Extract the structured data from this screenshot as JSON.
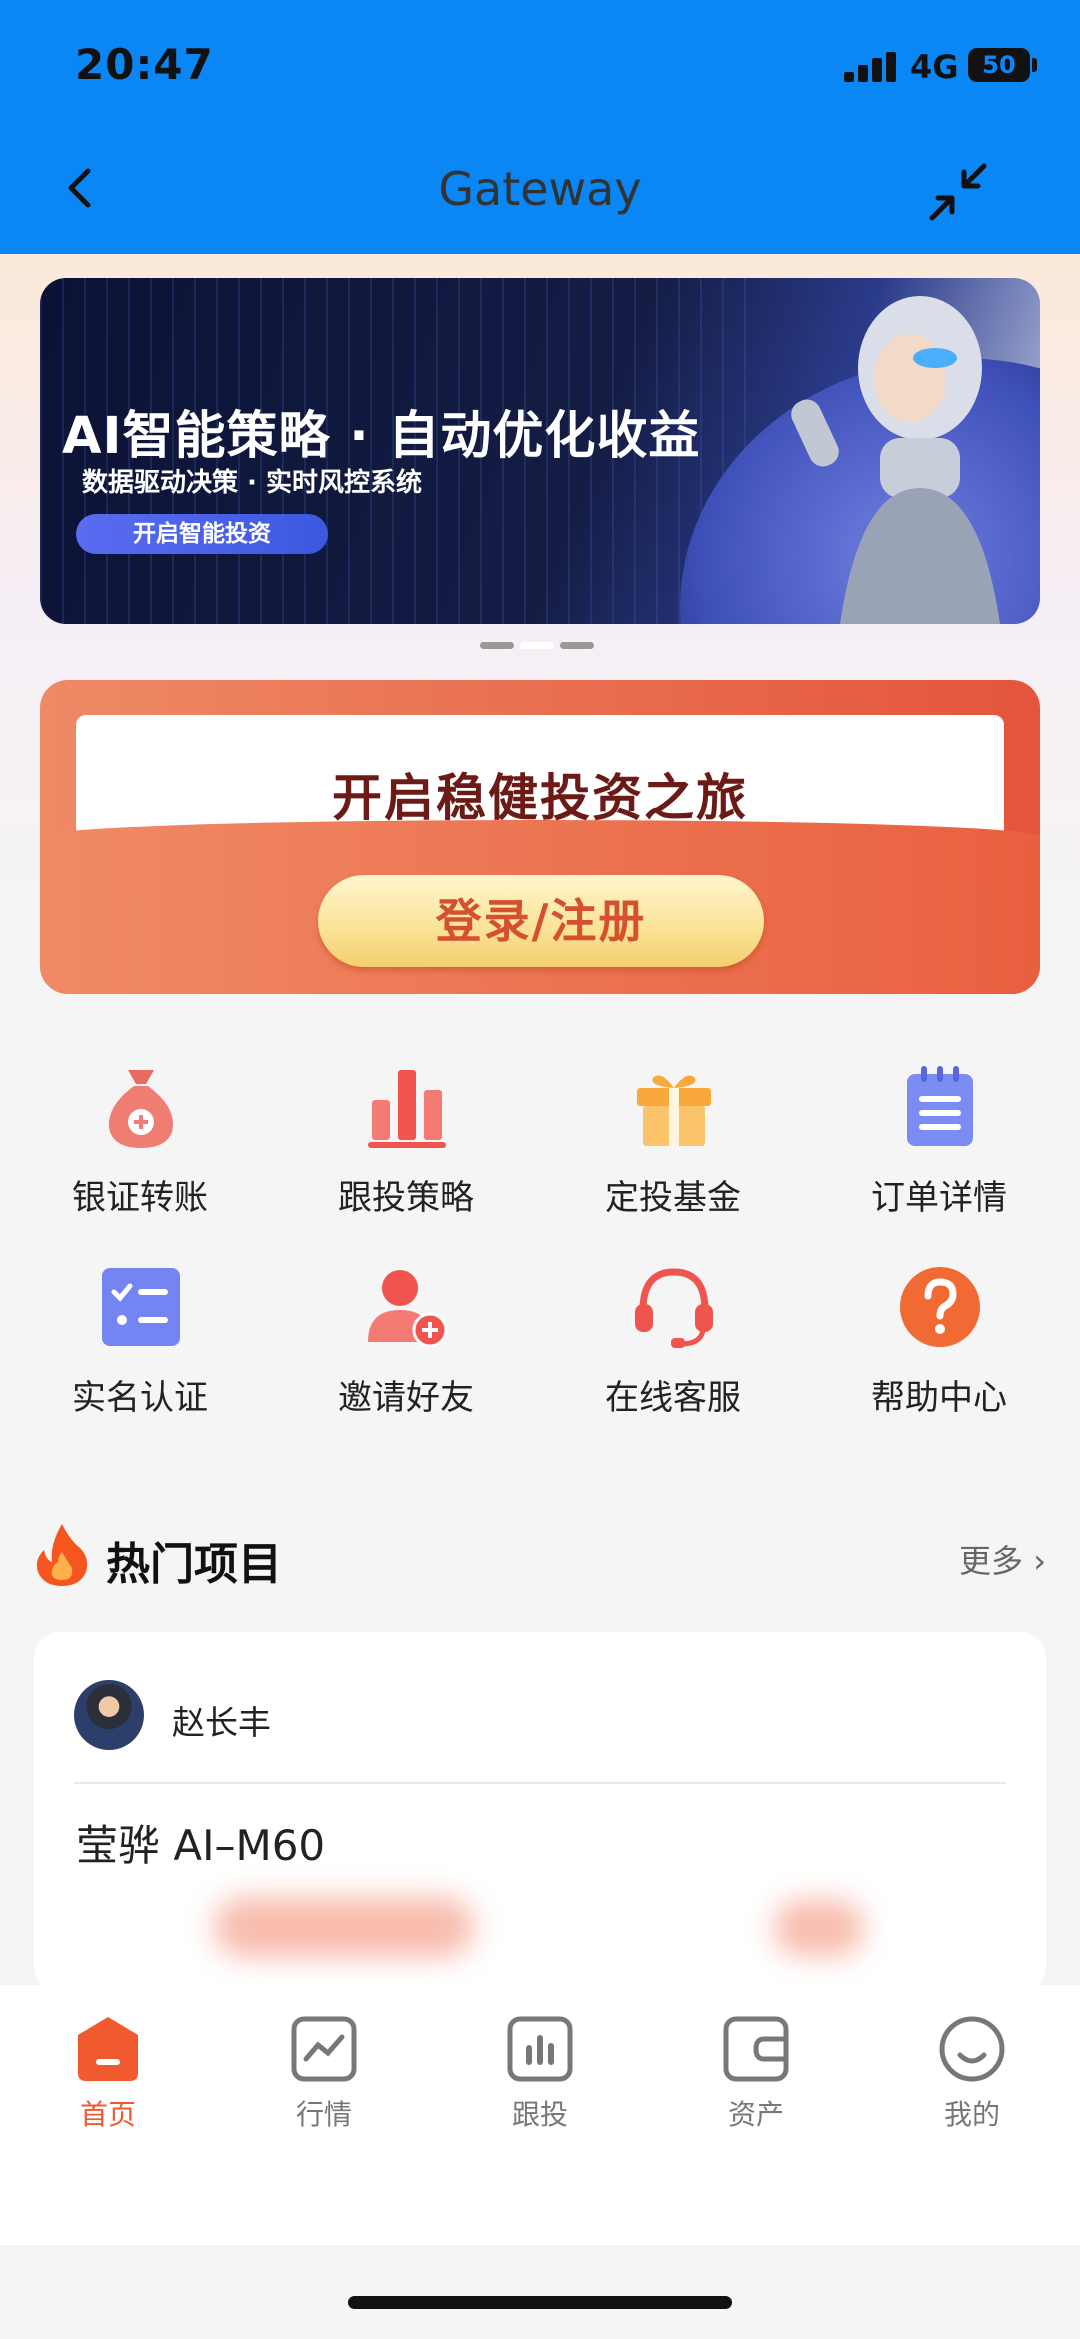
{
  "status_bar": {
    "time": "20:47",
    "network": "4G",
    "battery": "50"
  },
  "header": {
    "title": "Gateway"
  },
  "banner": {
    "title": "AI智能策略 · 自动优化收益",
    "subtitle": "数据驱动决策 · 实时风控系统",
    "button": "开启智能投资",
    "pager": {
      "count": 3,
      "active": 2
    }
  },
  "login_card": {
    "headline": "开启稳健投资之旅",
    "button": "登录/注册"
  },
  "quick_menu": [
    {
      "label": "银证转账",
      "icon": "money-bag-icon",
      "color": "#e96a5e"
    },
    {
      "label": "跟投策略",
      "icon": "bar-chart-icon",
      "color": "#f0544f"
    },
    {
      "label": "定投基金",
      "icon": "gift-icon",
      "color": "#f8b54a"
    },
    {
      "label": "订单详情",
      "icon": "notepad-icon",
      "color": "#6f7ef2"
    },
    {
      "label": "实名认证",
      "icon": "checklist-icon",
      "color": "#6f7ef2"
    },
    {
      "label": "邀请好友",
      "icon": "add-user-icon",
      "color": "#f0544f"
    },
    {
      "label": "在线客服",
      "icon": "headset-icon",
      "color": "#f0544f"
    },
    {
      "label": "帮助中心",
      "icon": "help-icon",
      "color": "#f26a33"
    }
  ],
  "hot": {
    "title": "热门项目",
    "more": "更多",
    "item": {
      "manager": "赵长丰",
      "product": "莹骅 AI–M60"
    }
  },
  "tabs": [
    {
      "label": "首页",
      "icon": "home-icon",
      "active": true
    },
    {
      "label": "行情",
      "icon": "market-chart-icon",
      "active": false
    },
    {
      "label": "跟投",
      "icon": "follow-chart-icon",
      "active": false
    },
    {
      "label": "资产",
      "icon": "wallet-icon",
      "active": false
    },
    {
      "label": "我的",
      "icon": "profile-face-icon",
      "active": false
    }
  ]
}
